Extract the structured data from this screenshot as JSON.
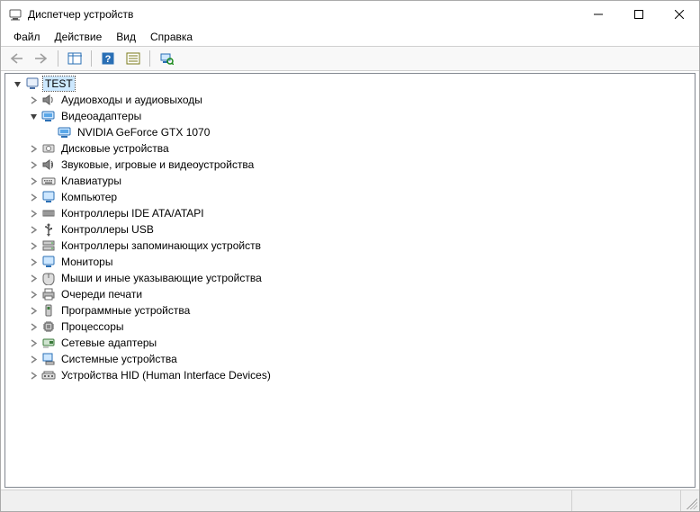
{
  "window": {
    "title": "Диспетчер устройств"
  },
  "menu": {
    "file": "Файл",
    "action": "Действие",
    "view": "Вид",
    "help": "Справка"
  },
  "tree": {
    "root": "TEST",
    "audio": "Аудиовходы и аудиовыходы",
    "display_adapters": "Видеоадаптеры",
    "gpu": "NVIDIA GeForce GTX 1070",
    "disk": "Дисковые устройства",
    "sound": "Звуковые, игровые и видеоустройства",
    "keyboards": "Клавиатуры",
    "computer": "Компьютер",
    "ide": "Контроллеры IDE ATA/ATAPI",
    "usb": "Контроллеры USB",
    "storage": "Контроллеры запоминающих устройств",
    "monitors": "Мониторы",
    "mice": "Мыши и иные указывающие устройства",
    "print_queues": "Очереди печати",
    "software_devices": "Программные устройства",
    "processors": "Процессоры",
    "network": "Сетевые адаптеры",
    "system": "Системные устройства",
    "hid": "Устройства HID (Human Interface Devices)"
  }
}
